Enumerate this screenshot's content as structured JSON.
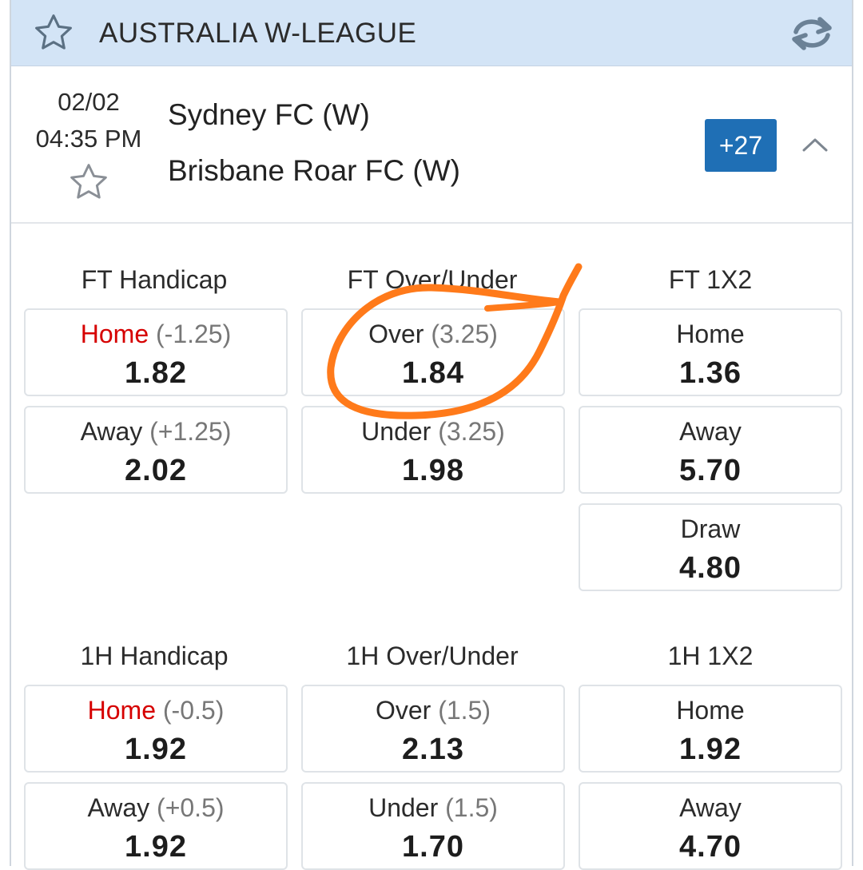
{
  "league": {
    "title": "AUSTRALIA W-LEAGUE"
  },
  "match": {
    "date": "02/02",
    "time": "04:35 PM",
    "home_team": "Sydney FC (W)",
    "away_team": "Brisbane Roar FC (W)",
    "more_markets": "+27"
  },
  "markets": {
    "ft_handicap": {
      "title": "FT Handicap",
      "home": {
        "side": "Home",
        "line": "(-1.25)",
        "odds": "1.82"
      },
      "away": {
        "side": "Away",
        "line": "(+1.25)",
        "odds": "2.02"
      }
    },
    "ft_over_under": {
      "title": "FT Over/Under",
      "over": {
        "side": "Over",
        "line": "(3.25)",
        "odds": "1.84"
      },
      "under": {
        "side": "Under",
        "line": "(3.25)",
        "odds": "1.98"
      }
    },
    "ft_1x2": {
      "title": "FT 1X2",
      "home": {
        "side": "Home",
        "odds": "1.36"
      },
      "away": {
        "side": "Away",
        "odds": "5.70"
      },
      "draw": {
        "side": "Draw",
        "odds": "4.80"
      }
    },
    "h1_handicap": {
      "title": "1H Handicap",
      "home": {
        "side": "Home",
        "line": "(-0.5)",
        "odds": "1.92"
      },
      "away": {
        "side": "Away",
        "line": "(+0.5)",
        "odds": "1.92"
      }
    },
    "h1_over_under": {
      "title": "1H Over/Under",
      "over": {
        "side": "Over",
        "line": "(1.5)",
        "odds": "2.13"
      },
      "under": {
        "side": "Under",
        "line": "(1.5)",
        "odds": "1.70"
      }
    },
    "h1_1x2": {
      "title": "1H 1X2",
      "home": {
        "side": "Home",
        "odds": "1.92"
      },
      "away": {
        "side": "Away",
        "odds": "4.70"
      }
    }
  },
  "colors": {
    "accent": "#1f6fb5",
    "header_bg": "#d3e4f6",
    "home_highlight": "#d60000",
    "annotation": "#ff7a1a"
  },
  "icons": {
    "league_star": "star-outline-icon",
    "refresh": "refresh-icon",
    "match_star": "star-outline-icon",
    "collapse": "chevron-up-icon"
  }
}
